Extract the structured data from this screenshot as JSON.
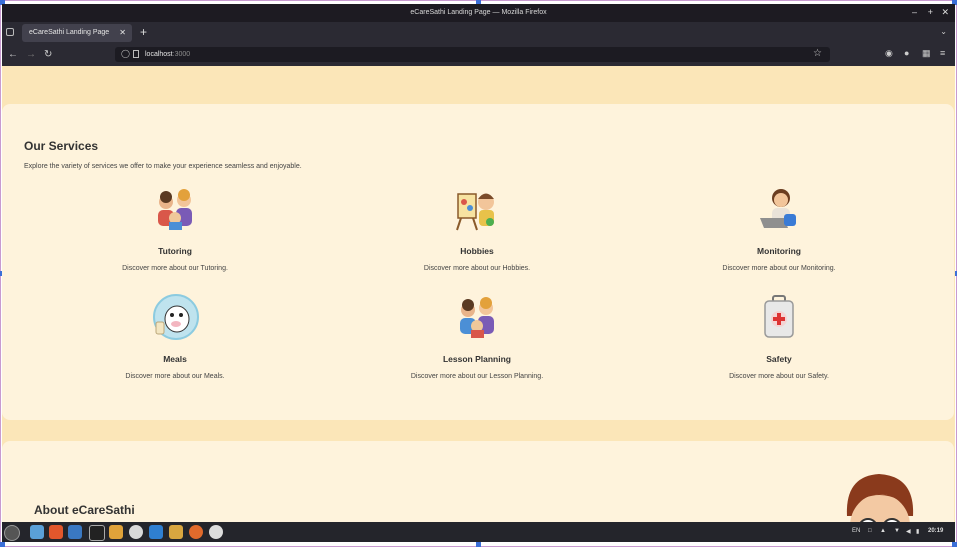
{
  "window": {
    "title": "eCareSathi Landing Page — Mozilla Firefox",
    "controls": [
      "‒",
      "+",
      "✕"
    ]
  },
  "browser": {
    "tab_label": "eCareSathi Landing Page",
    "tab_close": "✕",
    "new_tab": "+",
    "tab_menu": "⌄",
    "url_host": "localhost",
    "url_port": ":3000"
  },
  "services_section": {
    "title": "Our Services",
    "subtitle": "Explore the variety of services we offer to make your experience seamless and enjoyable.",
    "items": [
      {
        "name": "Tutoring",
        "desc": "Discover more about our Tutoring."
      },
      {
        "name": "Hobbies",
        "desc": "Discover more about our Hobbies."
      },
      {
        "name": "Monitoring",
        "desc": "Discover more about our Monitoring."
      },
      {
        "name": "Meals",
        "desc": "Discover more about our Meals."
      },
      {
        "name": "Lesson Planning",
        "desc": "Discover more about our Lesson Planning."
      },
      {
        "name": "Safety",
        "desc": "Discover more about our Safety."
      }
    ]
  },
  "about_section": {
    "title": "About eCareSathi"
  },
  "taskbar": {
    "tray_lang": "EN",
    "clock": "20:19"
  },
  "colors": {
    "page_bg": "#fbe6b8",
    "card_bg": "#fef3dc",
    "browser_chrome": "#2b2a33"
  }
}
